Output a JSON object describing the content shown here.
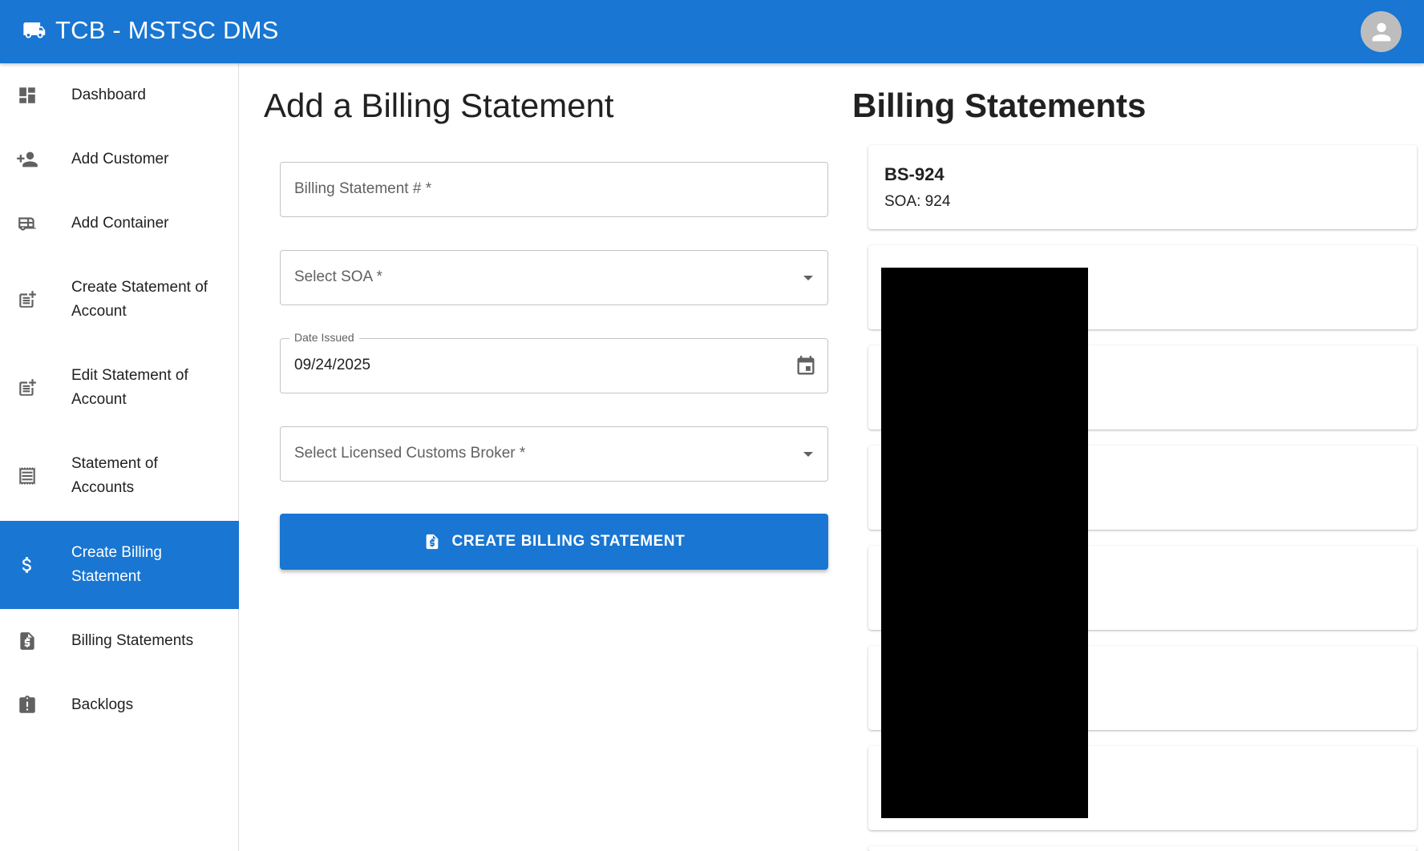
{
  "appbar": {
    "title": "TCB - MSTSC DMS",
    "color": "#1976d2"
  },
  "sidebar": {
    "items": [
      {
        "label": "Dashboard",
        "icon": "dashboard-icon"
      },
      {
        "label": "Add Customer",
        "icon": "person-add-icon"
      },
      {
        "label": "Add Container",
        "icon": "rv-container-icon"
      },
      {
        "label": "Create Statement of Account",
        "icon": "post-add-icon"
      },
      {
        "label": "Edit Statement of Account",
        "icon": "post-add-icon"
      },
      {
        "label": "Statement of Accounts",
        "icon": "receipt-icon"
      },
      {
        "label": "Create Billing Statement",
        "icon": "dollar-icon",
        "active": true
      },
      {
        "label": "Billing Statements",
        "icon": "request-quote-icon"
      },
      {
        "label": "Backlogs",
        "icon": "assignment-late-icon"
      }
    ]
  },
  "form": {
    "title": "Add a Billing Statement",
    "billing_statement_placeholder": "Billing Statement # *",
    "soa_placeholder": "Select SOA *",
    "date_label": "Date Issued",
    "date_value": "09/24/2025",
    "broker_placeholder": "Select Licensed Customs Broker *",
    "submit_label": "CREATE BILLING STATEMENT"
  },
  "list": {
    "title": "Billing Statements",
    "cards": [
      {
        "title": "BS-924",
        "subtitle": "SOA: 924"
      }
    ]
  }
}
